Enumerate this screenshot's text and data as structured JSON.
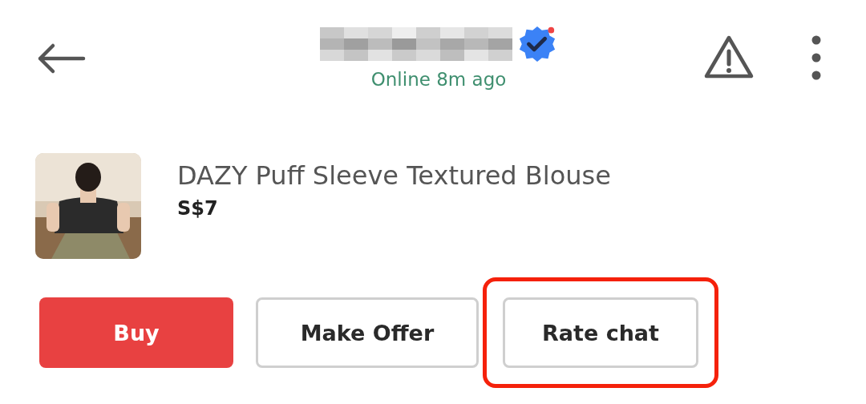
{
  "header": {
    "name_redacted": true,
    "verified": true,
    "status": "Online 8m ago"
  },
  "product": {
    "title": "DAZY Puff Sleeve Textured Blouse",
    "price": "S$7"
  },
  "buttons": [
    {
      "label": "Buy",
      "kind": "primary",
      "highlighted": false
    },
    {
      "label": "Make Offer",
      "kind": "outline",
      "highlighted": false
    },
    {
      "label": "Rate chat",
      "kind": "outline",
      "highlighted": true
    }
  ]
}
